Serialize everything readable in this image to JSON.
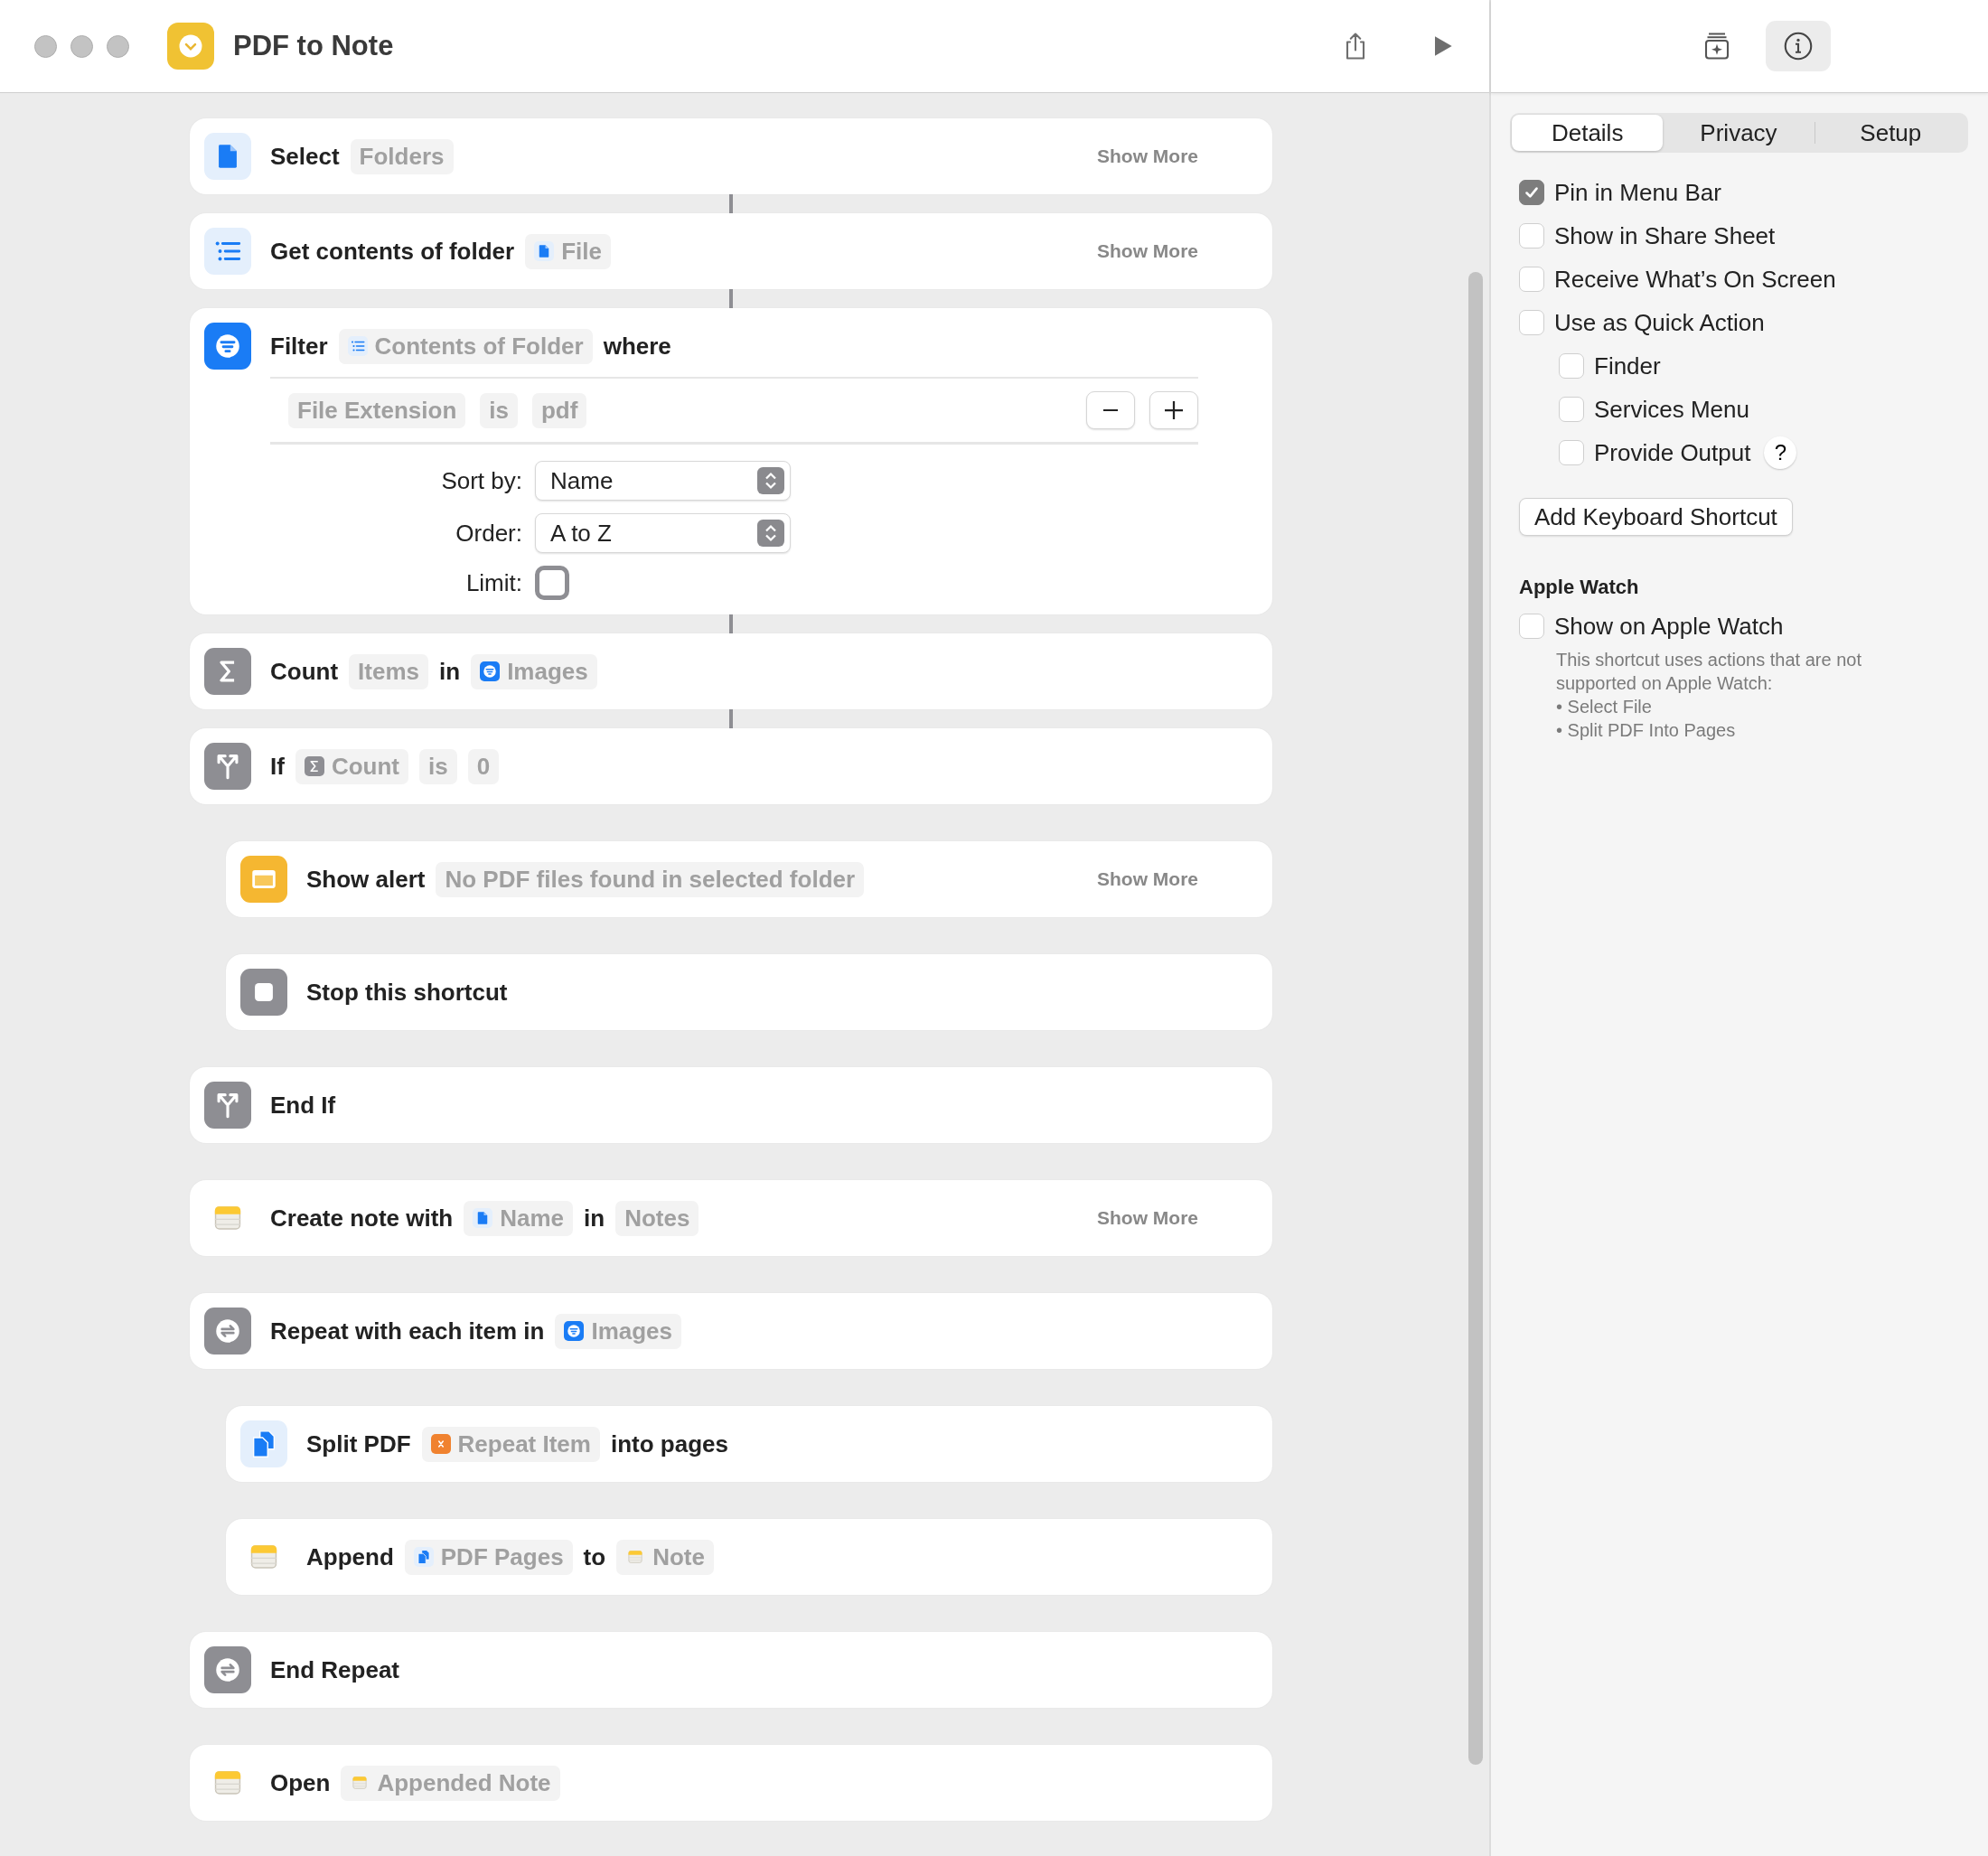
{
  "window": {
    "title": "PDF to Note"
  },
  "actions": [
    {
      "kind": "file",
      "linked": true,
      "show_more": "Show More",
      "parts": [
        {
          "kind": "text",
          "text": "Select"
        },
        {
          "kind": "token",
          "text": "Folders"
        }
      ]
    },
    {
      "kind": "list",
      "linked": true,
      "show_more": "Show More",
      "parts": [
        {
          "kind": "text",
          "text": "Get contents of folder"
        },
        {
          "kind": "file",
          "text": "File"
        }
      ]
    },
    {
      "kind": "filter",
      "linked": true,
      "parts": [
        {
          "kind": "text",
          "text": "Filter"
        },
        {
          "kind": "list",
          "text": "Contents of Folder"
        },
        {
          "kind": "text",
          "text": "where"
        }
      ],
      "filter": {
        "condition": [
          "File Extension",
          "is",
          "pdf"
        ],
        "options": [
          {
            "kind": "popup",
            "label": "Sort by:",
            "value": "Name"
          },
          {
            "kind": "popup",
            "label": "Order:",
            "value": "A to Z"
          },
          {
            "kind": "checkbox",
            "label": "Limit:",
            "checked": false
          }
        ]
      }
    },
    {
      "kind": "sigma",
      "linked": true,
      "parts": [
        {
          "kind": "text",
          "text": "Count"
        },
        {
          "kind": "token",
          "text": "Items"
        },
        {
          "kind": "text",
          "text": "in"
        },
        {
          "kind": "filter",
          "text": "Images"
        }
      ]
    },
    {
      "kind": "branch",
      "linked": false,
      "parts": [
        {
          "kind": "text",
          "text": "If"
        },
        {
          "kind": "sigma",
          "text": "Count"
        },
        {
          "kind": "token",
          "text": "is"
        },
        {
          "kind": "token",
          "text": "0"
        }
      ],
      "children": [
        {
          "kind": "alert",
          "linked": false,
          "show_more": "Show More",
          "parts": [
            {
              "kind": "text",
              "text": "Show alert"
            },
            {
              "kind": "token",
              "text": "No PDF files found in selected folder"
            }
          ]
        },
        {
          "kind": "stop",
          "linked": false,
          "parts": [
            {
              "kind": "text",
              "text": "Stop this shortcut"
            }
          ]
        }
      ]
    },
    {
      "kind": "branch",
      "linked": false,
      "parts": [
        {
          "kind": "text",
          "text": "End If"
        }
      ]
    },
    {
      "kind": "notes",
      "linked": false,
      "show_more": "Show More",
      "parts": [
        {
          "kind": "text",
          "text": "Create note with"
        },
        {
          "kind": "file",
          "text": "Name"
        },
        {
          "kind": "text",
          "text": "in"
        },
        {
          "kind": "token",
          "text": "Notes"
        }
      ]
    },
    {
      "kind": "repeat",
      "linked": false,
      "parts": [
        {
          "kind": "text",
          "text": "Repeat with each item in"
        },
        {
          "kind": "filter",
          "text": "Images"
        }
      ],
      "children": [
        {
          "kind": "split",
          "linked": false,
          "parts": [
            {
              "kind": "text",
              "text": "Split PDF"
            },
            {
              "kind": "variable",
              "text": "Repeat Item"
            },
            {
              "kind": "text",
              "text": "into pages"
            }
          ]
        },
        {
          "kind": "notes",
          "linked": false,
          "parts": [
            {
              "kind": "text",
              "text": "Append"
            },
            {
              "kind": "split",
              "text": "PDF Pages"
            },
            {
              "kind": "text",
              "text": "to"
            },
            {
              "kind": "notes",
              "text": "Note"
            }
          ]
        }
      ]
    },
    {
      "kind": "repeat",
      "linked": false,
      "parts": [
        {
          "kind": "text",
          "text": "End Repeat"
        }
      ]
    },
    {
      "kind": "notes",
      "linked": false,
      "parts": [
        {
          "kind": "text",
          "text": "Open"
        },
        {
          "kind": "notes",
          "text": "Appended Note"
        }
      ]
    }
  ],
  "inspector": {
    "toolbar": [
      {
        "kind": "library",
        "selected": false
      },
      {
        "kind": "info",
        "selected": true
      }
    ],
    "tabs": [
      {
        "label": "Details",
        "selected": true
      },
      {
        "label": "Privacy",
        "selected": false
      },
      {
        "label": "Setup",
        "selected": false
      }
    ],
    "options": [
      {
        "label": "Pin in Menu Bar",
        "checked": true
      },
      {
        "label": "Show in Share Sheet",
        "checked": false
      },
      {
        "label": "Receive What’s On Screen",
        "checked": false
      },
      {
        "label": "Use as Quick Action",
        "checked": false,
        "children": [
          {
            "label": "Finder",
            "checked": false
          },
          {
            "label": "Services Menu",
            "checked": false
          },
          {
            "label": "Provide Output",
            "checked": false,
            "help": "?"
          }
        ]
      }
    ],
    "shortcut_button": "Add Keyboard Shortcut",
    "watch": {
      "heading": "Apple Watch",
      "option": {
        "label": "Show on Apple Watch",
        "checked": false
      },
      "note": "This shortcut uses actions that are not supported on Apple Watch:",
      "items": [
        "• Select File",
        "• Split PDF Into Pages"
      ]
    }
  }
}
